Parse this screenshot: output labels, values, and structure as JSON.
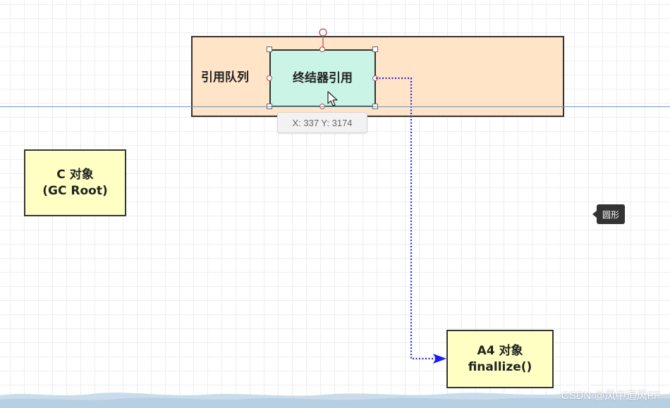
{
  "diagram": {
    "queue_label": "引用队列",
    "finalizer_label": "终结器引用",
    "c_object": {
      "line1": "C 对象",
      "line2": "(GC Root)"
    },
    "a4_object": {
      "line1": "A4 对象",
      "line2": "finallize()"
    }
  },
  "overlays": {
    "coordinate_tooltip": "X: 337  Y: 3174",
    "shape_tooltip": "圆形",
    "watermark": "CSDN @风中追风FF"
  },
  "colors": {
    "queue_fill": "#ffe4c8",
    "finalizer_fill": "#c9f4e6",
    "object_fill": "#ffffc4",
    "connector": "#2b2bd6",
    "guide_line": "#5b9bd5"
  }
}
